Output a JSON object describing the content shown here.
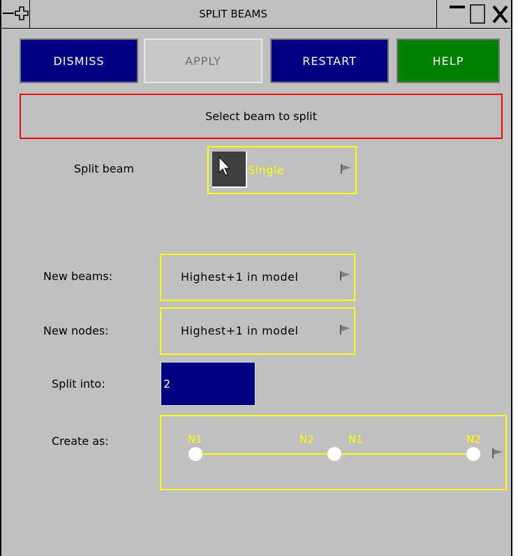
{
  "window": {
    "title": "SPLIT BEAMS"
  },
  "toolbar": {
    "dismiss": "DISMISS",
    "apply": "APPLY",
    "restart": "RESTART",
    "help": "HELP"
  },
  "message": "Select beam to split",
  "split_beam": {
    "label": "Split beam",
    "value": "Single"
  },
  "new_beams": {
    "label": "New beams:",
    "value": "Highest+1 in model"
  },
  "new_nodes": {
    "label": "New nodes:",
    "value": "Highest+1 in model"
  },
  "split_into": {
    "label": "Split into:",
    "value": "2"
  },
  "create_as": {
    "label": "Create as:",
    "node_labels": [
      "N1",
      "N2",
      "N1",
      "N2"
    ]
  },
  "colors": {
    "panel": "#c0c0c0",
    "navy": "#000080",
    "green": "#008000",
    "yellow": "#ffff00",
    "red": "#ff0000"
  }
}
